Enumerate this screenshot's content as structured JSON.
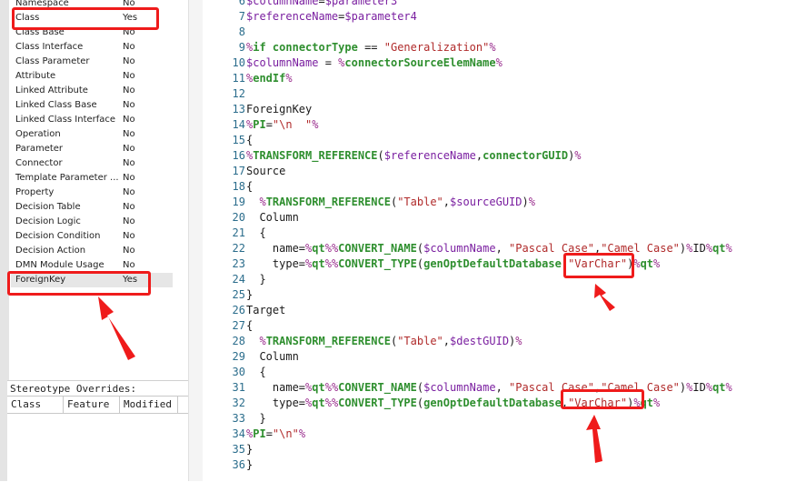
{
  "transforms": [
    {
      "name": "Namespace",
      "override": "No"
    },
    {
      "name": "Class",
      "override": "Yes"
    },
    {
      "name": "Class Base",
      "override": "No"
    },
    {
      "name": "Class Interface",
      "override": "No"
    },
    {
      "name": "Class Parameter",
      "override": "No"
    },
    {
      "name": "Attribute",
      "override": "No"
    },
    {
      "name": "Linked Attribute",
      "override": "No"
    },
    {
      "name": "Linked Class Base",
      "override": "No"
    },
    {
      "name": "Linked Class Interface",
      "override": "No"
    },
    {
      "name": "Operation",
      "override": "No"
    },
    {
      "name": "Parameter",
      "override": "No"
    },
    {
      "name": "Connector",
      "override": "No"
    },
    {
      "name": "Template Parameter ...",
      "override": "No"
    },
    {
      "name": "Property",
      "override": "No"
    },
    {
      "name": "Decision Table",
      "override": "No"
    },
    {
      "name": "Decision Logic",
      "override": "No"
    },
    {
      "name": "Decision Condition",
      "override": "No"
    },
    {
      "name": "Decision Action",
      "override": "No"
    },
    {
      "name": "DMN Module Usage",
      "override": "No"
    },
    {
      "name": "ForeignKey",
      "override": "Yes"
    }
  ],
  "selected_transform": "ForeignKey",
  "stereotype_overrides": {
    "title": "Stereotype Overrides:",
    "columns": [
      "Class",
      "Feature",
      "Modified"
    ]
  },
  "code_lines": [
    {
      "n": "6",
      "t": [
        [
          "v",
          "$columnName"
        ],
        [
          "p",
          "="
        ],
        [
          "v",
          "$parameter3"
        ]
      ]
    },
    {
      "n": "7",
      "t": [
        [
          "v",
          "$referenceName"
        ],
        [
          "p",
          "="
        ],
        [
          "v",
          "$parameter4"
        ]
      ]
    },
    {
      "n": "8",
      "t": []
    },
    {
      "n": "9",
      "t": [
        [
          "m",
          "%"
        ],
        [
          "k",
          "if"
        ],
        [
          "p",
          " "
        ],
        [
          "k",
          "connectorType"
        ],
        [
          "p",
          " == "
        ],
        [
          "s",
          "\"Generalization\""
        ],
        [
          "m",
          "%"
        ]
      ]
    },
    {
      "n": "10",
      "t": [
        [
          "v",
          "$columnName"
        ],
        [
          "p",
          " = "
        ],
        [
          "m",
          "%"
        ],
        [
          "k",
          "connectorSourceElemName"
        ],
        [
          "m",
          "%"
        ]
      ]
    },
    {
      "n": "11",
      "t": [
        [
          "m",
          "%"
        ],
        [
          "k",
          "endIf"
        ],
        [
          "m",
          "%"
        ]
      ]
    },
    {
      "n": "12",
      "t": []
    },
    {
      "n": "13",
      "t": [
        [
          "p",
          "ForeignKey"
        ]
      ]
    },
    {
      "n": "14",
      "t": [
        [
          "m",
          "%"
        ],
        [
          "k",
          "PI"
        ],
        [
          "p",
          "="
        ],
        [
          "s",
          "\"\\n  \""
        ],
        [
          "m",
          "%"
        ]
      ]
    },
    {
      "n": "15",
      "t": [
        [
          "p",
          "{"
        ]
      ]
    },
    {
      "n": "16",
      "t": [
        [
          "m",
          "%"
        ],
        [
          "k",
          "TRANSFORM_REFERENCE"
        ],
        [
          "p",
          "("
        ],
        [
          "v",
          "$referenceName"
        ],
        [
          "p",
          ","
        ],
        [
          "k",
          "connectorGUID"
        ],
        [
          "p",
          ")"
        ],
        [
          "m",
          "%"
        ]
      ]
    },
    {
      "n": "17",
      "t": [
        [
          "p",
          "Source"
        ]
      ]
    },
    {
      "n": "18",
      "t": [
        [
          "p",
          "{"
        ]
      ]
    },
    {
      "n": "19",
      "t": [
        [
          "p",
          "  "
        ],
        [
          "m",
          "%"
        ],
        [
          "k",
          "TRANSFORM_REFERENCE"
        ],
        [
          "p",
          "("
        ],
        [
          "s",
          "\"Table\""
        ],
        [
          "p",
          ","
        ],
        [
          "v",
          "$sourceGUID"
        ],
        [
          "p",
          ")"
        ],
        [
          "m",
          "%"
        ]
      ]
    },
    {
      "n": "20",
      "t": [
        [
          "p",
          "  Column"
        ]
      ]
    },
    {
      "n": "21",
      "t": [
        [
          "p",
          "  {"
        ]
      ]
    },
    {
      "n": "22",
      "t": [
        [
          "p",
          "    name="
        ],
        [
          "m",
          "%"
        ],
        [
          "k",
          "qt"
        ],
        [
          "m",
          "%%"
        ],
        [
          "k",
          "CONVERT_NAME"
        ],
        [
          "p",
          "("
        ],
        [
          "v",
          "$columnName"
        ],
        [
          "p",
          ", "
        ],
        [
          "s",
          "\"Pascal Case\""
        ],
        [
          "p",
          ","
        ],
        [
          "s",
          "\"Camel Case\""
        ],
        [
          "p",
          ")"
        ],
        [
          "m",
          "%"
        ],
        [
          "p",
          "ID"
        ],
        [
          "m",
          "%"
        ],
        [
          "k",
          "qt"
        ],
        [
          "m",
          "%"
        ]
      ]
    },
    {
      "n": "23",
      "t": [
        [
          "p",
          "    type="
        ],
        [
          "m",
          "%"
        ],
        [
          "k",
          "qt"
        ],
        [
          "m",
          "%%"
        ],
        [
          "k",
          "CONVERT_TYPE"
        ],
        [
          "p",
          "("
        ],
        [
          "k",
          "genOptDefaultDatabase"
        ],
        [
          "p",
          ","
        ],
        [
          "s",
          "\"VarChar\""
        ],
        [
          "p",
          ")"
        ],
        [
          "m",
          "%"
        ],
        [
          "k",
          "qt"
        ],
        [
          "m",
          "%"
        ]
      ]
    },
    {
      "n": "24",
      "t": [
        [
          "p",
          "  }"
        ]
      ]
    },
    {
      "n": "25",
      "t": [
        [
          "p",
          "}"
        ]
      ]
    },
    {
      "n": "26",
      "t": [
        [
          "p",
          "Target"
        ]
      ]
    },
    {
      "n": "27",
      "t": [
        [
          "p",
          "{"
        ]
      ]
    },
    {
      "n": "28",
      "t": [
        [
          "p",
          "  "
        ],
        [
          "m",
          "%"
        ],
        [
          "k",
          "TRANSFORM_REFERENCE"
        ],
        [
          "p",
          "("
        ],
        [
          "s",
          "\"Table\""
        ],
        [
          "p",
          ","
        ],
        [
          "v",
          "$destGUID"
        ],
        [
          "p",
          ")"
        ],
        [
          "m",
          "%"
        ]
      ]
    },
    {
      "n": "29",
      "t": [
        [
          "p",
          "  Column"
        ]
      ]
    },
    {
      "n": "30",
      "t": [
        [
          "p",
          "  {"
        ]
      ]
    },
    {
      "n": "31",
      "t": [
        [
          "p",
          "    name="
        ],
        [
          "m",
          "%"
        ],
        [
          "k",
          "qt"
        ],
        [
          "m",
          "%%"
        ],
        [
          "k",
          "CONVERT_NAME"
        ],
        [
          "p",
          "("
        ],
        [
          "v",
          "$columnName"
        ],
        [
          "p",
          ", "
        ],
        [
          "s",
          "\"Pascal Case\""
        ],
        [
          "p",
          ","
        ],
        [
          "s",
          "\"Camel Case\""
        ],
        [
          "p",
          ")"
        ],
        [
          "m",
          "%"
        ],
        [
          "p",
          "ID"
        ],
        [
          "m",
          "%"
        ],
        [
          "k",
          "qt"
        ],
        [
          "m",
          "%"
        ]
      ]
    },
    {
      "n": "32",
      "t": [
        [
          "p",
          "    type="
        ],
        [
          "m",
          "%"
        ],
        [
          "k",
          "qt"
        ],
        [
          "m",
          "%%"
        ],
        [
          "k",
          "CONVERT_TYPE"
        ],
        [
          "p",
          "("
        ],
        [
          "k",
          "genOptDefaultDatabase"
        ],
        [
          "p",
          ","
        ],
        [
          "s",
          "\"VarChar\""
        ],
        [
          "p",
          ")"
        ],
        [
          "m",
          "%"
        ],
        [
          "k",
          "qt"
        ],
        [
          "m",
          "%"
        ]
      ]
    },
    {
      "n": "33",
      "t": [
        [
          "p",
          "  }"
        ]
      ]
    },
    {
      "n": "34",
      "t": [
        [
          "m",
          "%"
        ],
        [
          "k",
          "PI"
        ],
        [
          "p",
          "="
        ],
        [
          "s",
          "\"\\n\""
        ],
        [
          "m",
          "%"
        ]
      ]
    },
    {
      "n": "35",
      "t": [
        [
          "p",
          "}"
        ]
      ]
    },
    {
      "n": "36",
      "t": [
        [
          "p",
          "}"
        ]
      ]
    }
  ],
  "annotation_color": "#ef1b1b"
}
